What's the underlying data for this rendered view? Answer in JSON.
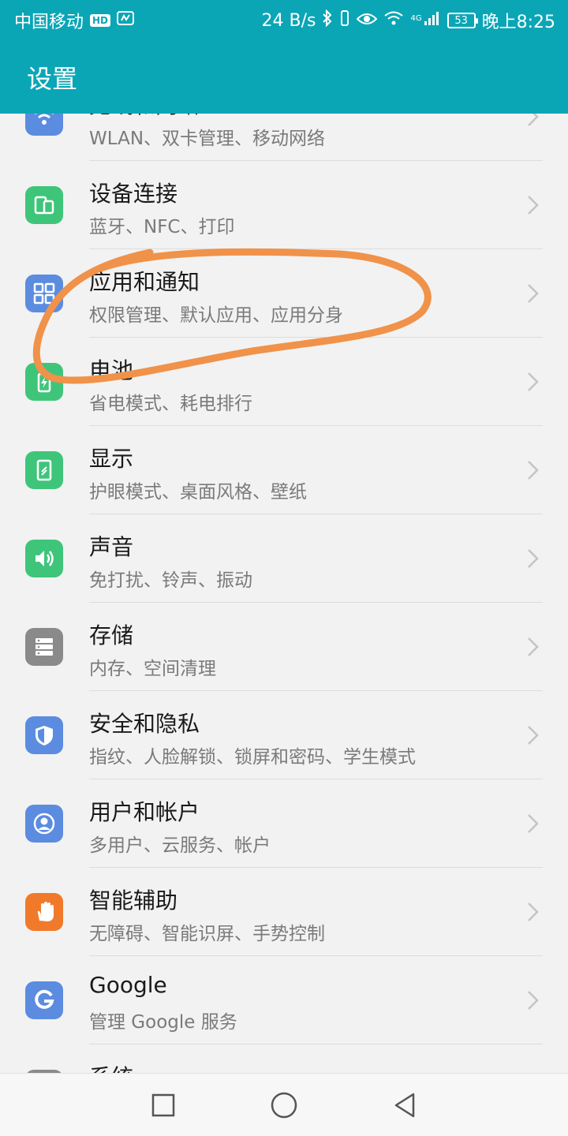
{
  "status_bar": {
    "carrier": "中国移动",
    "hd": "HD",
    "net_speed": "24 B/s",
    "network": "4G",
    "battery": "53",
    "time": "晚上8:25"
  },
  "header": {
    "title": "设置"
  },
  "items": [
    {
      "title": "无线和网络",
      "subtitle": "WLAN、双卡管理、移动网络",
      "icon": "wifi-icon",
      "color": "#5b8ce0"
    },
    {
      "title": "设备连接",
      "subtitle": "蓝牙、NFC、打印",
      "icon": "device-connect-icon",
      "color": "#3fc57a"
    },
    {
      "title": "应用和通知",
      "subtitle": "权限管理、默认应用、应用分身",
      "icon": "apps-icon",
      "color": "#5b8ce0"
    },
    {
      "title": "电池",
      "subtitle": "省电模式、耗电排行",
      "icon": "battery-icon",
      "color": "#3fc57a"
    },
    {
      "title": "显示",
      "subtitle": "护眼模式、桌面风格、壁纸",
      "icon": "display-icon",
      "color": "#3fc57a"
    },
    {
      "title": "声音",
      "subtitle": "免打扰、铃声、振动",
      "icon": "sound-icon",
      "color": "#3fc57a"
    },
    {
      "title": "存储",
      "subtitle": "内存、空间清理",
      "icon": "storage-icon",
      "color": "#8a8a8a"
    },
    {
      "title": "安全和隐私",
      "subtitle": "指纹、人脸解锁、锁屏和密码、学生模式",
      "icon": "shield-icon",
      "color": "#5b8ce0"
    },
    {
      "title": "用户和帐户",
      "subtitle": "多用户、云服务、帐户",
      "icon": "user-icon",
      "color": "#5b8ce0"
    },
    {
      "title": "智能辅助",
      "subtitle": "无障碍、智能识屏、手势控制",
      "icon": "hand-icon",
      "color": "#f07a2a"
    },
    {
      "title": "Google",
      "subtitle": "管理 Google 服务",
      "icon": "google-icon",
      "color": "#5b8ce0"
    },
    {
      "title": "系统",
      "subtitle": "",
      "icon": "system-icon",
      "color": "#8a8a8a"
    }
  ],
  "annotation": {
    "color": "#f0924a"
  },
  "nav": {
    "recents": "recents-icon",
    "home": "home-icon",
    "back": "back-icon"
  }
}
